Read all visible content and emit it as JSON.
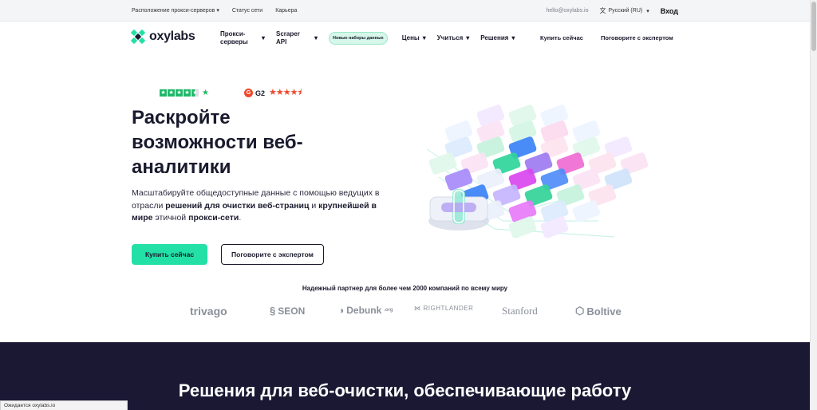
{
  "topbar": {
    "proxy_locations": "Расположение прокси-серверов",
    "network_status": "Статус сети",
    "careers": "Карьера",
    "email": "hello@oxylabs.io",
    "language": "Русский (RU)",
    "login": "Вход"
  },
  "nav": {
    "logo_text": "oxylabs",
    "items": [
      {
        "label": "Прокси-серверы"
      },
      {
        "label": "Scraper API"
      }
    ],
    "badge": "Новые наборы данных",
    "prices": "Цены",
    "learn": "Учиться",
    "solutions": "Решения",
    "buy_now": "Купить сейчас",
    "talk_expert": "Поговорите с экспертом"
  },
  "ratings": {
    "g2_label": "G2"
  },
  "hero": {
    "title": "Раскройте возможности веб-аналитики",
    "desc_1": "Масштабируйте общедоступные данные с помощью ведущих в отрасли ",
    "desc_b1": "решений для очистки веб-страниц",
    "desc_2": " и ",
    "desc_b2": "крупнейшей в мире",
    "desc_3": " этичной ",
    "desc_b3": "прокси-сети",
    "desc_4": ".",
    "buy_button": "Купить сейчас",
    "expert_button": "Поговорите с экспертом"
  },
  "partners": {
    "title": "Надежный партнер для более чем 2000 компаний по всему миру",
    "logos": [
      "trivago",
      "SEON",
      "Debunk",
      "RIGHTLANDER",
      "Stanford",
      "Boltive"
    ],
    "debunk_suffix": ".org"
  },
  "dark_section": {
    "title": "Решения для веб-очистки, обеспечивающие работу"
  },
  "status_bar": {
    "text": "Ожидается oxylabs.io"
  },
  "colors": {
    "accent": "#23e0a6",
    "dark": "#1a1833",
    "trustpilot": "#21b86a",
    "g2": "#ef492d"
  }
}
